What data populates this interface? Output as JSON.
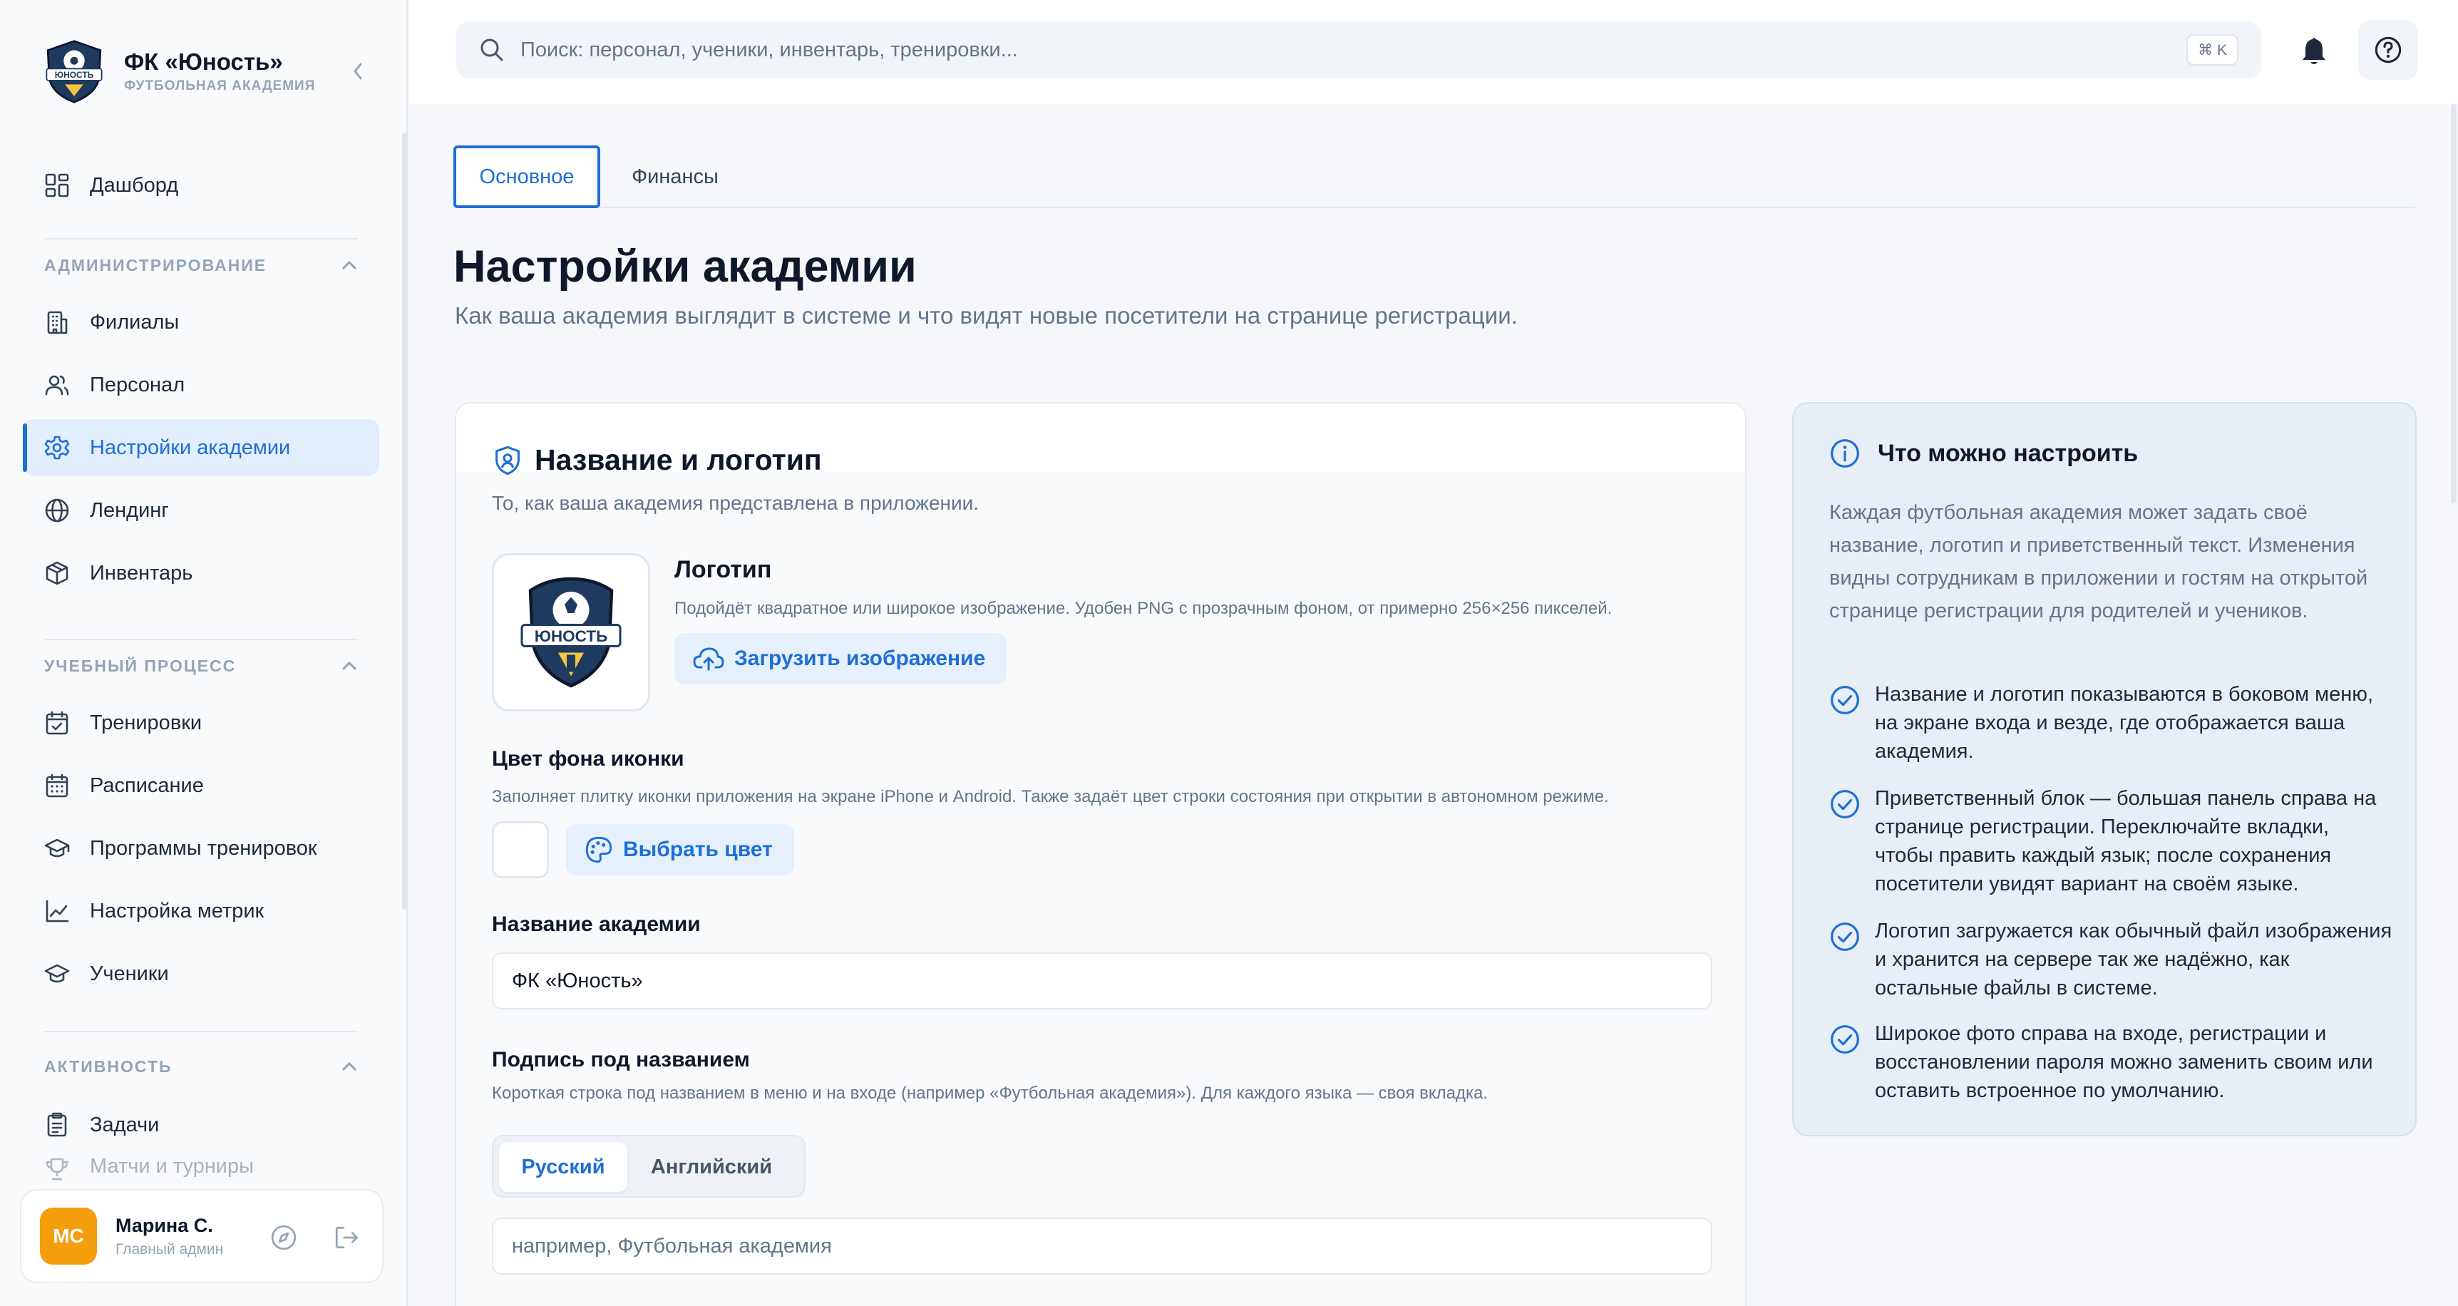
{
  "brand": {
    "title": "ФК «Юность»",
    "subtitle": "ФУТБОЛЬНАЯ АКАДЕМИЯ",
    "logo_text": "ЮНОСТЬ"
  },
  "sidebar": {
    "dashboard": "Дашборд",
    "sections": [
      {
        "title": "АДМИНИСТРИРОВАНИЕ",
        "items": [
          "Филиалы",
          "Персонал",
          "Настройки академии",
          "Лендинг",
          "Инвентарь"
        ]
      },
      {
        "title": "УЧЕБНЫЙ ПРОЦЕСС",
        "items": [
          "Тренировки",
          "Расписание",
          "Программы тренировок",
          "Настройка метрик",
          "Ученики"
        ]
      },
      {
        "title": "АКТИВНОСТЬ",
        "items": [
          "Задачи",
          "Матчи и турниры"
        ]
      }
    ],
    "active_item": "Настройки академии"
  },
  "user": {
    "initials": "МС",
    "name": "Марина С.",
    "role": "Главный админ"
  },
  "topbar": {
    "search_placeholder": "Поиск: персонал, ученики, инвентарь, тренировки...",
    "shortcut": "⌘ K"
  },
  "tabs": [
    "Основное",
    "Финансы"
  ],
  "page": {
    "title": "Настройки академии",
    "subtitle": "Как ваша академия выглядит в системе и что видят новые посетители на странице регистрации."
  },
  "card": {
    "title": "Название и логотип",
    "description": "То, как ваша академия представлена в приложении.",
    "logo_label": "Логотип",
    "logo_hint": "Подойдёт квадратное или широкое изображение. Удобен PNG с прозрачным фоном, от примерно 256×256 пикселей.",
    "upload_button": "Загрузить изображение",
    "icon_bg_label": "Цвет фона иконки",
    "icon_bg_hint": "Заполняет плитку иконки приложения на экране iPhone и Android. Также задаёт цвет строки состояния при открытии в автономном режиме.",
    "pick_color_button": "Выбрать цвет",
    "name_label": "Название академии",
    "name_value": "ФК «Юность»",
    "caption_label": "Подпись под названием",
    "caption_hint": "Короткая строка под названием в меню и на входе (например «Футбольная академия»). Для каждого языка — своя вкладка.",
    "languages": [
      "Русский",
      "Английский"
    ],
    "caption_placeholder": "например, Футбольная академия"
  },
  "info": {
    "title": "Что можно настроить",
    "intro": "Каждая футбольная академия может задать своё название, логотип и приветственный текст. Изменения видны сотрудникам в приложении и гостям на открытой странице регистрации для родителей и учеников.",
    "items": [
      "Название и логотип показываются в боковом меню, на экране входа и везде, где отображается ваша академия.",
      "Приветственный блок — большая панель справа на странице регистрации. Переключайте вкладки, чтобы править каждый язык; после сохранения посетители увидят вариант на своём языке.",
      "Логотип загружается как обычный файл изображения и хранится на сервере так же надёжно, как остальные файлы в системе.",
      "Широкое фото справа на входе, регистрации и восстановлении пароля можно заменить своим или оставить встроенное по умолчанию."
    ]
  },
  "colors": {
    "accent": "#1d6fd6",
    "avatar": "#f59e0b",
    "logo_navy": "#1e3a5f"
  }
}
